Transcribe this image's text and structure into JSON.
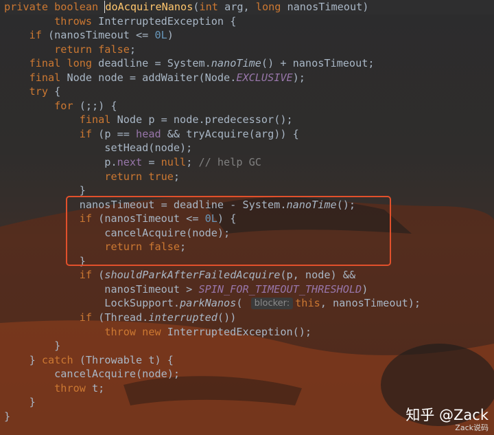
{
  "code_lines": [
    [
      [
        "kw",
        "private boolean "
      ],
      [
        "fn caret",
        "d"
      ],
      [
        "fn",
        "oAcquireNanos"
      ],
      [
        "plain",
        "("
      ],
      [
        "kw",
        "int "
      ],
      [
        "plain",
        "arg, "
      ],
      [
        "kw",
        "long "
      ],
      [
        "plain",
        "nanosTimeout)"
      ]
    ],
    [
      [
        "plain",
        "        "
      ],
      [
        "kw",
        "throws "
      ],
      [
        "plain",
        "InterruptedException {"
      ]
    ],
    [
      [
        "plain",
        "    "
      ],
      [
        "kw",
        "if "
      ],
      [
        "plain",
        "(nanosTimeout <= "
      ],
      [
        "num",
        "0L"
      ],
      [
        "plain",
        ")"
      ]
    ],
    [
      [
        "plain",
        "        "
      ],
      [
        "kw",
        "return false"
      ],
      [
        "plain",
        ";"
      ]
    ],
    [
      [
        "plain",
        "    "
      ],
      [
        "kw",
        "final long "
      ],
      [
        "plain",
        "deadline = System."
      ],
      [
        "plain ital",
        "nanoTime"
      ],
      [
        "plain",
        "() + nanosTimeout;"
      ]
    ],
    [
      [
        "plain",
        "    "
      ],
      [
        "kw",
        "final "
      ],
      [
        "plain",
        "Node node = addWaiter(Node."
      ],
      [
        "field ital",
        "EXCLUSIVE"
      ],
      [
        "plain",
        ");"
      ]
    ],
    [
      [
        "plain",
        "    "
      ],
      [
        "kw",
        "try "
      ],
      [
        "plain",
        "{"
      ]
    ],
    [
      [
        "plain",
        "        "
      ],
      [
        "kw",
        "for "
      ],
      [
        "plain",
        "(;;) {"
      ]
    ],
    [
      [
        "plain",
        "            "
      ],
      [
        "kw",
        "final "
      ],
      [
        "plain",
        "Node p = node.predecessor();"
      ]
    ],
    [
      [
        "plain",
        "            "
      ],
      [
        "kw",
        "if "
      ],
      [
        "plain",
        "(p == "
      ],
      [
        "field",
        "head "
      ],
      [
        "plain",
        "&& tryAcquire(arg)) {"
      ]
    ],
    [
      [
        "plain",
        "                setHead(node);"
      ]
    ],
    [
      [
        "plain",
        "                p."
      ],
      [
        "field",
        "next "
      ],
      [
        "plain",
        "= "
      ],
      [
        "kw",
        "null"
      ],
      [
        "plain",
        "; "
      ],
      [
        "cmt",
        "// help GC"
      ]
    ],
    [
      [
        "plain",
        "                "
      ],
      [
        "kw",
        "return true"
      ],
      [
        "plain",
        ";"
      ]
    ],
    [
      [
        "plain",
        "            }"
      ]
    ],
    [
      [
        "plain",
        "            nanosTimeout = deadline - System."
      ],
      [
        "plain ital",
        "nanoTime"
      ],
      [
        "plain",
        "();"
      ]
    ],
    [
      [
        "plain",
        "            "
      ],
      [
        "kw",
        "if "
      ],
      [
        "plain",
        "(nanosTimeout <= "
      ],
      [
        "num",
        "0L"
      ],
      [
        "plain",
        ") {"
      ]
    ],
    [
      [
        "plain",
        "                cancelAcquire(node);"
      ]
    ],
    [
      [
        "plain",
        "                "
      ],
      [
        "kw",
        "return false"
      ],
      [
        "plain",
        ";"
      ]
    ],
    [
      [
        "plain",
        "            }"
      ]
    ],
    [
      [
        "plain",
        "            "
      ],
      [
        "kw",
        "if "
      ],
      [
        "plain",
        "("
      ],
      [
        "plain ital",
        "shouldParkAfterFailedAcquire"
      ],
      [
        "plain",
        "(p, node) &&"
      ]
    ],
    [
      [
        "plain",
        "                nanosTimeout > "
      ],
      [
        "field ital",
        "SPIN_FOR_TIMEOUT_THRESHOLD"
      ],
      [
        "plain",
        ")"
      ]
    ],
    [
      [
        "plain",
        "                LockSupport."
      ],
      [
        "plain ital",
        "parkNanos"
      ],
      [
        "plain",
        "( "
      ],
      [
        "hint",
        "blocker:"
      ],
      [
        "kw",
        "this"
      ],
      [
        "plain",
        ", nanosTimeout);"
      ]
    ],
    [
      [
        "plain",
        "            "
      ],
      [
        "kw",
        "if "
      ],
      [
        "plain",
        "(Thread."
      ],
      [
        "plain ital",
        "interrupted"
      ],
      [
        "plain",
        "())"
      ]
    ],
    [
      [
        "plain",
        "                "
      ],
      [
        "kw",
        "throw new "
      ],
      [
        "plain",
        "InterruptedException();"
      ]
    ],
    [
      [
        "plain",
        "        }"
      ]
    ],
    [
      [
        "plain",
        "    } "
      ],
      [
        "kw",
        "catch "
      ],
      [
        "plain",
        "(Throwable t) {"
      ]
    ],
    [
      [
        "plain",
        "        cancelAcquire(node);"
      ]
    ],
    [
      [
        "plain",
        "        "
      ],
      [
        "kw",
        "throw "
      ],
      [
        "plain",
        "t;"
      ]
    ],
    [
      [
        "plain",
        "    }"
      ]
    ],
    [
      [
        "plain",
        "}"
      ]
    ]
  ],
  "watermark": {
    "main": "知乎 @Zack",
    "sub": "Zack说码"
  },
  "colors": {
    "keyword": "#cc7832",
    "number": "#6897bb",
    "method_decl": "#ffc66d",
    "field": "#9876aa",
    "comment": "#808080",
    "text": "#a9b7c6",
    "highlight_box": "#e2502b"
  }
}
